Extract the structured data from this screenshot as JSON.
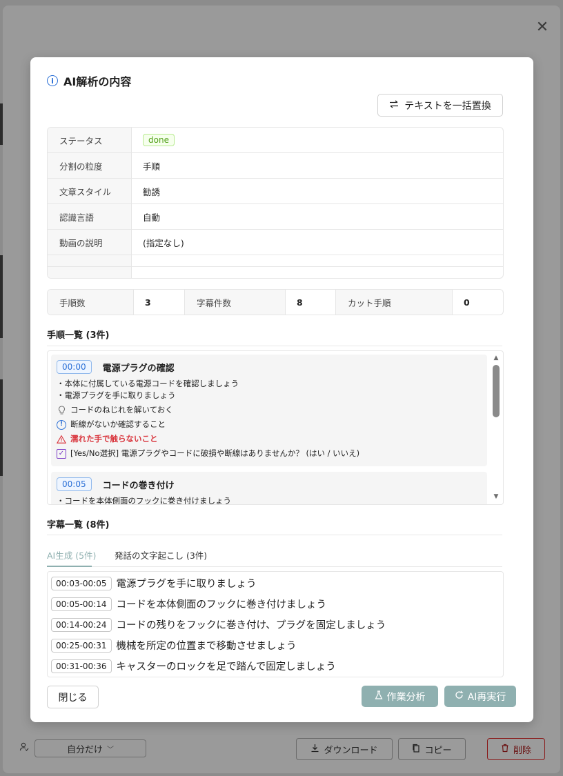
{
  "modal": {
    "title": "AI解析の内容",
    "replace_button": "テキストを一括置換",
    "details": [
      {
        "label": "ステータス",
        "value": "done"
      },
      {
        "label": "分割の粒度",
        "value": "手順"
      },
      {
        "label": "文章スタイル",
        "value": "勧誘"
      },
      {
        "label": "認識言語",
        "value": "自動"
      },
      {
        "label": "動画の説明",
        "value": "(指定なし)"
      }
    ],
    "stats": [
      {
        "label": "手順数",
        "value": "3"
      },
      {
        "label": "字幕件数",
        "value": "8"
      },
      {
        "label": "カット手順",
        "value": "0"
      }
    ],
    "steps_section_title": "手順一覧 (3件)",
    "steps": [
      {
        "time": "00:00",
        "title": "電源プラグの確認",
        "lines": [
          "・本体に付属している電源コードを確認しましょう",
          "・電源プラグを手に取りましょう"
        ],
        "notes": [
          {
            "type": "tip",
            "icon": "lightbulb-icon",
            "text": "コードのねじれを解いておく"
          },
          {
            "type": "info",
            "icon": "info-icon",
            "text": "断線がないか確認すること"
          },
          {
            "type": "warning",
            "icon": "warning-icon",
            "text": "濡れた手で触らないこと"
          },
          {
            "type": "check",
            "icon": "checkbox-icon",
            "text": "[Yes/No選択] 電源プラグやコードに破損や断線はありませんか？ (はい / いいえ)"
          }
        ]
      },
      {
        "time": "00:05",
        "title": "コードの巻き付け",
        "lines": [
          "・コードを本体側面のフックに巻き付けましょう"
        ]
      }
    ],
    "subtitles_section_title": "字幕一覧 (8件)",
    "tabs": [
      {
        "label": "AI生成 (5件)",
        "active": true
      },
      {
        "label": "発話の文字起こし (3件)",
        "active": false
      }
    ],
    "subtitles": [
      {
        "time": "00:03-00:05",
        "text": "電源プラグを手に取りましょう"
      },
      {
        "time": "00:05-00:14",
        "text": "コードを本体側面のフックに巻き付けましょう"
      },
      {
        "time": "00:14-00:24",
        "text": "コードの残りをフックに巻き付け、プラグを固定しましょう"
      },
      {
        "time": "00:25-00:31",
        "text": "機械を所定の位置まで移動させましょう"
      },
      {
        "time": "00:31-00:36",
        "text": "キャスターのロックを足で踏んで固定しましょう"
      }
    ],
    "close_button": "閉じる",
    "analyze_button": "作業分析",
    "rerun_button": "AI再実行"
  },
  "background": {
    "visibility_select": "自分だけ",
    "download_button": "ダウンロード",
    "copy_button": "コピー",
    "delete_button": "削除"
  },
  "colors": {
    "accent_disabled": "#8fb0b0",
    "info_blue": "#2a6fd6",
    "warning_red": "#d9363e",
    "success_green": "#52a11a"
  }
}
